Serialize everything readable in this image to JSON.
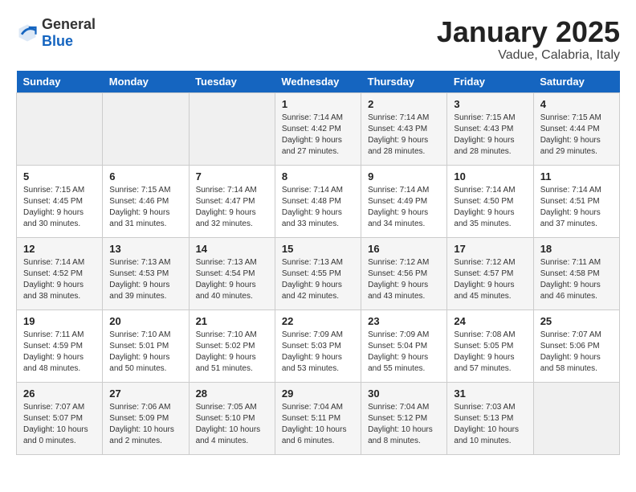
{
  "logo": {
    "text_general": "General",
    "text_blue": "Blue"
  },
  "title": "January 2025",
  "subtitle": "Vadue, Calabria, Italy",
  "weekdays": [
    "Sunday",
    "Monday",
    "Tuesday",
    "Wednesday",
    "Thursday",
    "Friday",
    "Saturday"
  ],
  "weeks": [
    [
      {
        "day": "",
        "sunrise": "",
        "sunset": "",
        "daylight": ""
      },
      {
        "day": "",
        "sunrise": "",
        "sunset": "",
        "daylight": ""
      },
      {
        "day": "",
        "sunrise": "",
        "sunset": "",
        "daylight": ""
      },
      {
        "day": "1",
        "sunrise": "Sunrise: 7:14 AM",
        "sunset": "Sunset: 4:42 PM",
        "daylight": "Daylight: 9 hours and 27 minutes."
      },
      {
        "day": "2",
        "sunrise": "Sunrise: 7:14 AM",
        "sunset": "Sunset: 4:43 PM",
        "daylight": "Daylight: 9 hours and 28 minutes."
      },
      {
        "day": "3",
        "sunrise": "Sunrise: 7:15 AM",
        "sunset": "Sunset: 4:43 PM",
        "daylight": "Daylight: 9 hours and 28 minutes."
      },
      {
        "day": "4",
        "sunrise": "Sunrise: 7:15 AM",
        "sunset": "Sunset: 4:44 PM",
        "daylight": "Daylight: 9 hours and 29 minutes."
      }
    ],
    [
      {
        "day": "5",
        "sunrise": "Sunrise: 7:15 AM",
        "sunset": "Sunset: 4:45 PM",
        "daylight": "Daylight: 9 hours and 30 minutes."
      },
      {
        "day": "6",
        "sunrise": "Sunrise: 7:15 AM",
        "sunset": "Sunset: 4:46 PM",
        "daylight": "Daylight: 9 hours and 31 minutes."
      },
      {
        "day": "7",
        "sunrise": "Sunrise: 7:14 AM",
        "sunset": "Sunset: 4:47 PM",
        "daylight": "Daylight: 9 hours and 32 minutes."
      },
      {
        "day": "8",
        "sunrise": "Sunrise: 7:14 AM",
        "sunset": "Sunset: 4:48 PM",
        "daylight": "Daylight: 9 hours and 33 minutes."
      },
      {
        "day": "9",
        "sunrise": "Sunrise: 7:14 AM",
        "sunset": "Sunset: 4:49 PM",
        "daylight": "Daylight: 9 hours and 34 minutes."
      },
      {
        "day": "10",
        "sunrise": "Sunrise: 7:14 AM",
        "sunset": "Sunset: 4:50 PM",
        "daylight": "Daylight: 9 hours and 35 minutes."
      },
      {
        "day": "11",
        "sunrise": "Sunrise: 7:14 AM",
        "sunset": "Sunset: 4:51 PM",
        "daylight": "Daylight: 9 hours and 37 minutes."
      }
    ],
    [
      {
        "day": "12",
        "sunrise": "Sunrise: 7:14 AM",
        "sunset": "Sunset: 4:52 PM",
        "daylight": "Daylight: 9 hours and 38 minutes."
      },
      {
        "day": "13",
        "sunrise": "Sunrise: 7:13 AM",
        "sunset": "Sunset: 4:53 PM",
        "daylight": "Daylight: 9 hours and 39 minutes."
      },
      {
        "day": "14",
        "sunrise": "Sunrise: 7:13 AM",
        "sunset": "Sunset: 4:54 PM",
        "daylight": "Daylight: 9 hours and 40 minutes."
      },
      {
        "day": "15",
        "sunrise": "Sunrise: 7:13 AM",
        "sunset": "Sunset: 4:55 PM",
        "daylight": "Daylight: 9 hours and 42 minutes."
      },
      {
        "day": "16",
        "sunrise": "Sunrise: 7:12 AM",
        "sunset": "Sunset: 4:56 PM",
        "daylight": "Daylight: 9 hours and 43 minutes."
      },
      {
        "day": "17",
        "sunrise": "Sunrise: 7:12 AM",
        "sunset": "Sunset: 4:57 PM",
        "daylight": "Daylight: 9 hours and 45 minutes."
      },
      {
        "day": "18",
        "sunrise": "Sunrise: 7:11 AM",
        "sunset": "Sunset: 4:58 PM",
        "daylight": "Daylight: 9 hours and 46 minutes."
      }
    ],
    [
      {
        "day": "19",
        "sunrise": "Sunrise: 7:11 AM",
        "sunset": "Sunset: 4:59 PM",
        "daylight": "Daylight: 9 hours and 48 minutes."
      },
      {
        "day": "20",
        "sunrise": "Sunrise: 7:10 AM",
        "sunset": "Sunset: 5:01 PM",
        "daylight": "Daylight: 9 hours and 50 minutes."
      },
      {
        "day": "21",
        "sunrise": "Sunrise: 7:10 AM",
        "sunset": "Sunset: 5:02 PM",
        "daylight": "Daylight: 9 hours and 51 minutes."
      },
      {
        "day": "22",
        "sunrise": "Sunrise: 7:09 AM",
        "sunset": "Sunset: 5:03 PM",
        "daylight": "Daylight: 9 hours and 53 minutes."
      },
      {
        "day": "23",
        "sunrise": "Sunrise: 7:09 AM",
        "sunset": "Sunset: 5:04 PM",
        "daylight": "Daylight: 9 hours and 55 minutes."
      },
      {
        "day": "24",
        "sunrise": "Sunrise: 7:08 AM",
        "sunset": "Sunset: 5:05 PM",
        "daylight": "Daylight: 9 hours and 57 minutes."
      },
      {
        "day": "25",
        "sunrise": "Sunrise: 7:07 AM",
        "sunset": "Sunset: 5:06 PM",
        "daylight": "Daylight: 9 hours and 58 minutes."
      }
    ],
    [
      {
        "day": "26",
        "sunrise": "Sunrise: 7:07 AM",
        "sunset": "Sunset: 5:07 PM",
        "daylight": "Daylight: 10 hours and 0 minutes."
      },
      {
        "day": "27",
        "sunrise": "Sunrise: 7:06 AM",
        "sunset": "Sunset: 5:09 PM",
        "daylight": "Daylight: 10 hours and 2 minutes."
      },
      {
        "day": "28",
        "sunrise": "Sunrise: 7:05 AM",
        "sunset": "Sunset: 5:10 PM",
        "daylight": "Daylight: 10 hours and 4 minutes."
      },
      {
        "day": "29",
        "sunrise": "Sunrise: 7:04 AM",
        "sunset": "Sunset: 5:11 PM",
        "daylight": "Daylight: 10 hours and 6 minutes."
      },
      {
        "day": "30",
        "sunrise": "Sunrise: 7:04 AM",
        "sunset": "Sunset: 5:12 PM",
        "daylight": "Daylight: 10 hours and 8 minutes."
      },
      {
        "day": "31",
        "sunrise": "Sunrise: 7:03 AM",
        "sunset": "Sunset: 5:13 PM",
        "daylight": "Daylight: 10 hours and 10 minutes."
      },
      {
        "day": "",
        "sunrise": "",
        "sunset": "",
        "daylight": ""
      }
    ]
  ]
}
